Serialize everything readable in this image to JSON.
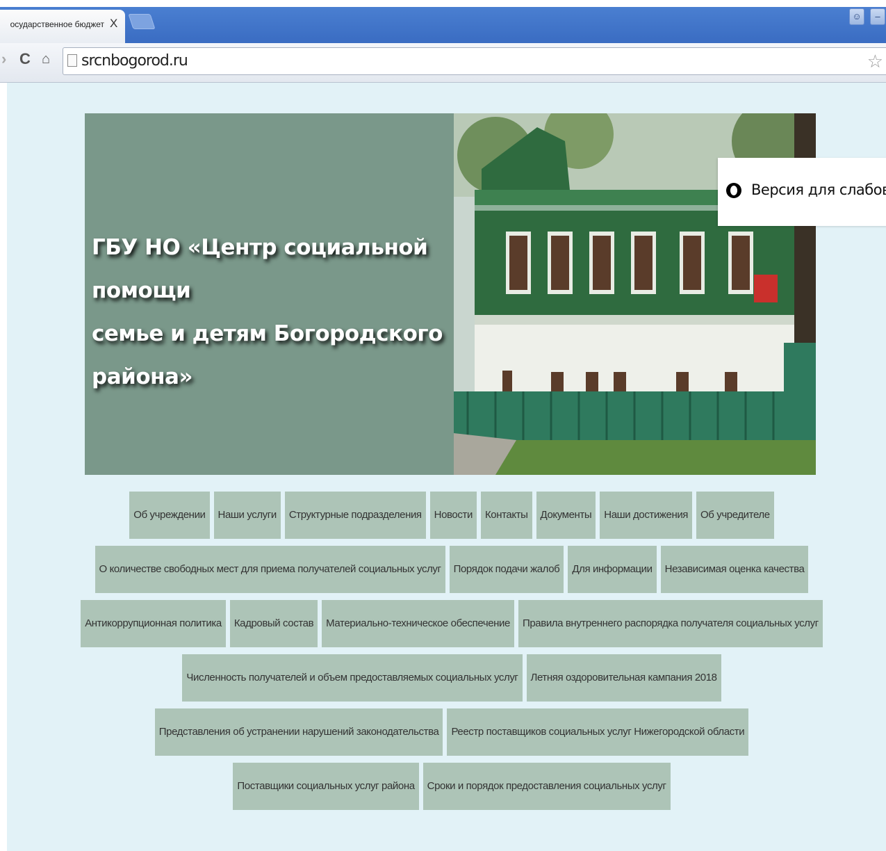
{
  "browser": {
    "tab_title": "осударственное бюджет",
    "tab_close": "X",
    "url": "srcnbogorod.ru",
    "window_user_icon": "user-icon",
    "window_minimize_icon": "minimize-icon"
  },
  "header": {
    "title_line1": "ГБУ НО «Центр социальной помощи",
    "title_line2": "семье и детям Богородского района»"
  },
  "low_vision": {
    "label": "Версия для слабови"
  },
  "menu_rows": [
    [
      "Об учреждении",
      "Наши услуги",
      "Структурные подразделения",
      "Новости",
      "Контакты",
      "Документы",
      "Наши достижения",
      "Об учредителе"
    ],
    [
      "О количестве свободных мест для приема получателей социальных услуг",
      "Порядок подачи жалоб",
      "Для информации",
      "Независимая оценка качества"
    ],
    [
      "Антикоррупционная политика",
      "Кадровый состав",
      "Материально-техническое обеспечение",
      "Правила внутреннего распорядка получателя социальных услуг"
    ],
    [
      "Численность получателей и объем предоставляемых социальных услуг",
      "Летняя оздоровительная кампания 2018"
    ],
    [
      "Представления об устранении нарушений законодательства",
      "Реестр поставщиков социальных услуг Нижегородской области"
    ],
    [
      "Поставщики социальных услуг района",
      "Сроки и порядок предоставления социальных услуг"
    ]
  ],
  "colors": {
    "page_bg": "#e2f2f7",
    "header_bg": "#7a988a",
    "menu_item_bg": "#adc4b7",
    "house_green": "#2f6b3f"
  }
}
